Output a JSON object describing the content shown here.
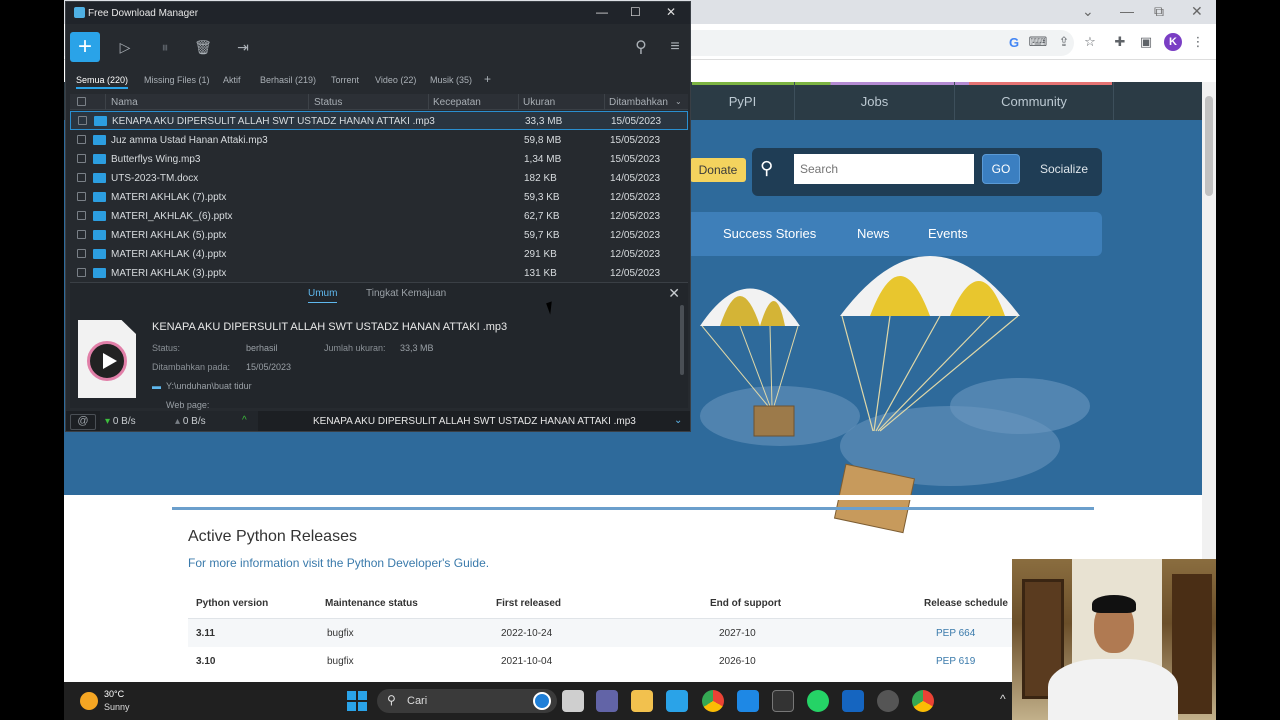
{
  "chrome": {
    "window_controls": [
      "⌄",
      "—",
      "⧉",
      "✕"
    ],
    "toolbar_icons": [
      "google-icon",
      "translate-icon",
      "share-icon",
      "star-icon",
      "extensions-icon",
      "sidepanel-icon"
    ],
    "avatar_letter": "K",
    "menu_glyph": "⋮"
  },
  "python_site": {
    "top_tabs": [
      "PyPI",
      "Jobs",
      "Community"
    ],
    "donate_label": "Donate",
    "search_placeholder": "Search",
    "go_label": "GO",
    "socialize_label": "Socialize",
    "nav_items": [
      "Success Stories",
      "News",
      "Events"
    ],
    "releases": {
      "title": "Active Python Releases",
      "subtitle": "For more information visit the Python Developer's Guide.",
      "headers": [
        "Python version",
        "Maintenance status",
        "First released",
        "End of support",
        "Release schedule"
      ],
      "rows": [
        {
          "version": "3.11",
          "status": "bugfix",
          "first": "2022-10-24",
          "end": "2027-10",
          "pep": "PEP 664"
        },
        {
          "version": "3.10",
          "status": "bugfix",
          "first": "2021-10-04",
          "end": "2026-10",
          "pep": "PEP 619"
        }
      ]
    },
    "colors": {
      "header_blue": "#2e6a9b",
      "nav_blue": "#3e7fb9",
      "donate_yellow": "#f4d35e"
    }
  },
  "fdm": {
    "title": "Free Download Manager",
    "window_controls": [
      "—",
      "☐",
      "✕"
    ],
    "tabs": [
      {
        "label": "Semua (220)",
        "active": true
      },
      {
        "label": "Missing Files (1)"
      },
      {
        "label": "Aktif"
      },
      {
        "label": "Berhasil (219)"
      },
      {
        "label": "Torrent"
      },
      {
        "label": "Video (22)"
      },
      {
        "label": "Musik (35)"
      },
      {
        "label": "+"
      }
    ],
    "columns": [
      "Nama",
      "Status",
      "Kecepatan",
      "Ukuran",
      "Ditambahkan"
    ],
    "files": [
      {
        "name": "KENAPA AKU DIPERSULIT ALLAH SWT  USTADZ HANAN ATTAKI .mp3",
        "size": "33,3 MB",
        "date": "15/05/2023",
        "selected": true
      },
      {
        "name": "Juz amma  Ustad Hanan Attaki.mp3",
        "size": "59,8 MB",
        "date": "15/05/2023"
      },
      {
        "name": "Butterflys Wing.mp3",
        "size": "1,34 MB",
        "date": "15/05/2023"
      },
      {
        "name": "UTS-2023-TM.docx",
        "size": "182 KB",
        "date": "14/05/2023"
      },
      {
        "name": "MATERI AKHLAK (7).pptx",
        "size": "59,3 KB",
        "date": "12/05/2023"
      },
      {
        "name": "MATERI_AKHLAK_(6).pptx",
        "size": "62,7 KB",
        "date": "12/05/2023"
      },
      {
        "name": "MATERI AKHLAK (5).pptx",
        "size": "59,7 KB",
        "date": "12/05/2023"
      },
      {
        "name": "MATERI AKHLAK (4).pptx",
        "size": "291 KB",
        "date": "12/05/2023"
      },
      {
        "name": "MATERI AKHLAK (3).pptx",
        "size": "131 KB",
        "date": "12/05/2023"
      }
    ],
    "detail": {
      "tabs": [
        "Umum",
        "Tingkat Kemajuan"
      ],
      "file_name": "KENAPA AKU DIPERSULIT ALLAH SWT  USTADZ HANAN ATTAKI .mp3",
      "status_label": "Status:",
      "status_value": "berhasil",
      "size_label": "Jumlah ukuran:",
      "size_value": "33,3 MB",
      "added_label": "Ditambahkan pada:",
      "added_value": "15/05/2023",
      "path": "Y:\\unduhan\\buat tidur",
      "webpage_label": "Web page:"
    },
    "status_bar": {
      "download_speed": "0 B/s",
      "upload_speed": "0 B/s",
      "current_file": "KENAPA AKU DIPERSULIT ALLAH SWT  USTADZ HANAN ATTAKI .mp3"
    }
  },
  "taskbar": {
    "weather_temp": "30°C",
    "weather_desc": "Sunny",
    "search_label": "Cari",
    "apps": [
      "file-explorer-icon",
      "zoom-icon",
      "folder-icon",
      "fdm-icon",
      "chrome-icon",
      "vscode-icon",
      "terminal-icon",
      "whatsapp-icon",
      "security-icon",
      "settings-icon",
      "chrome-profile-icon"
    ]
  }
}
